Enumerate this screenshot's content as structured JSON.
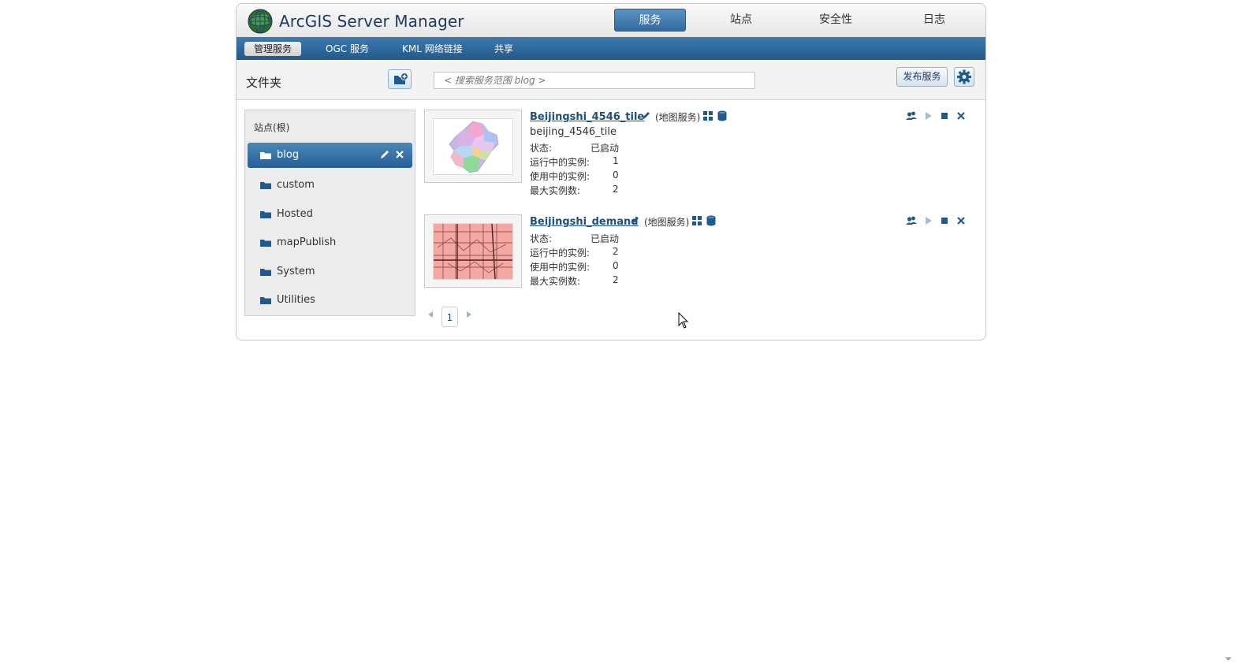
{
  "app": {
    "title": "ArcGIS Server Manager"
  },
  "nav": {
    "tabs": [
      {
        "label": "服务",
        "active": true
      },
      {
        "label": "站点",
        "active": false
      },
      {
        "label": "安全性",
        "active": false
      },
      {
        "label": "日志",
        "active": false
      }
    ],
    "subtabs": [
      {
        "label": "管理服务",
        "active": true
      },
      {
        "label": "OGC 服务",
        "active": false
      },
      {
        "label": "KML 网络链接",
        "active": false
      },
      {
        "label": "共享",
        "active": false
      }
    ]
  },
  "toolbar": {
    "folder_title": "文件夹",
    "search_placeholder": "< 搜索服务范围 blog >",
    "publish_label": "发布服务"
  },
  "sidebar": {
    "root_label": "站点(根)",
    "folders": [
      {
        "label": "blog",
        "active": true
      },
      {
        "label": "custom",
        "active": false
      },
      {
        "label": "Hosted",
        "active": false
      },
      {
        "label": "mapPublish",
        "active": false
      },
      {
        "label": "System",
        "active": false
      },
      {
        "label": "Utilities",
        "active": false
      }
    ]
  },
  "services": [
    {
      "name": "Beijingshi_4546_tile",
      "type": "(地图服务)",
      "subtitle": "beijing_4546_tile",
      "status_label": "状态:",
      "status_value": "已启动",
      "running_label": "运行中的实例:",
      "running_value": "1",
      "inuse_label": "使用中的实例:",
      "inuse_value": "0",
      "max_label": "最大实例数:",
      "max_value": "2"
    },
    {
      "name": "Beijingshi_demand",
      "type": "(地图服务)",
      "subtitle": "",
      "status_label": "状态:",
      "status_value": "已启动",
      "running_label": "运行中的实例:",
      "running_value": "2",
      "inuse_label": "使用中的实例:",
      "inuse_value": "0",
      "max_label": "最大实例数:",
      "max_value": "2"
    }
  ],
  "pager": {
    "current_page": "1"
  },
  "colors": {
    "accent": "#2f6aa0",
    "subnav": "#23588a",
    "link": "#1d4f80"
  }
}
